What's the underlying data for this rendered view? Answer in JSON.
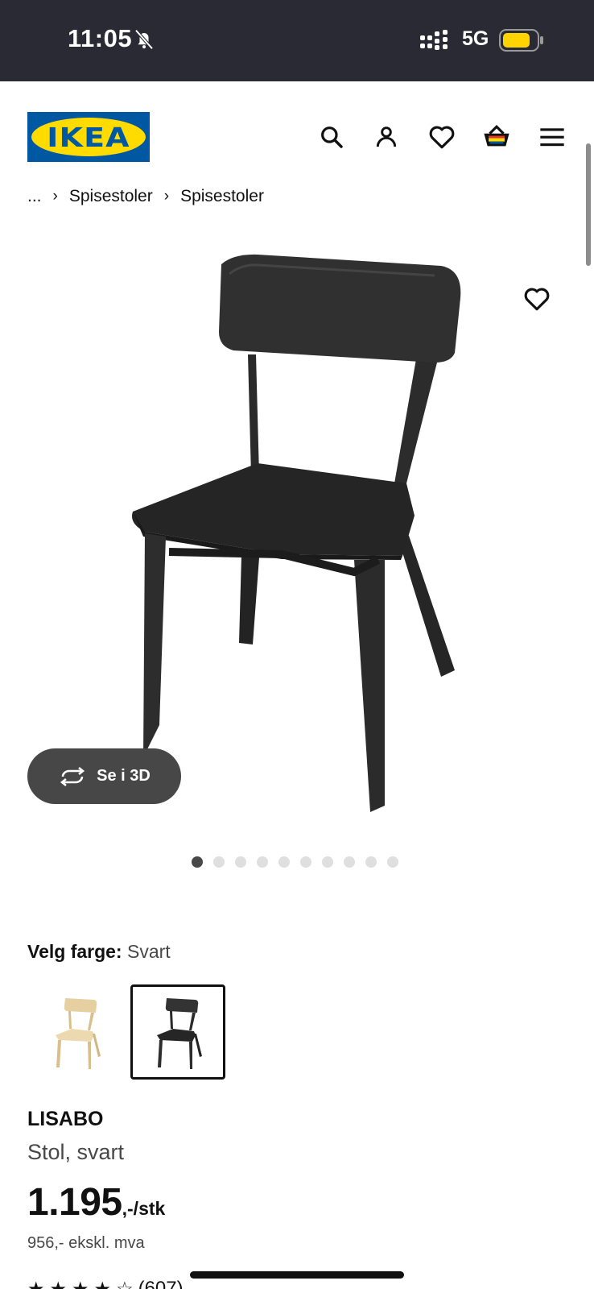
{
  "status_bar": {
    "time": "11:05",
    "network": "5G",
    "battery_color": "#ffd400"
  },
  "header": {
    "logo_text": "IKEA",
    "icons": [
      "search-icon",
      "account-icon",
      "favourites-icon",
      "cart-icon",
      "menu-icon"
    ]
  },
  "breadcrumb": {
    "items": [
      "...",
      "Spisestoler",
      "Spisestoler"
    ]
  },
  "gallery": {
    "see_3d_label": "Se i 3D",
    "image_count": 10,
    "active_index": 0
  },
  "color_choice": {
    "label": "Velg farge:",
    "value": "Svart",
    "swatches": [
      {
        "name": "light-wood",
        "color": "#e8d3a6",
        "selected": false
      },
      {
        "name": "black",
        "color": "#2b2b2b",
        "selected": true
      }
    ]
  },
  "product": {
    "name": "LISABO",
    "description": "Stol, svart",
    "price": "1.195",
    "price_suffix": ",-/stk",
    "price_excl_vat": "956,- ekskl. mva",
    "rating_count": "(607)"
  },
  "colors": {
    "accent_blue": "#0058a3",
    "accent_yellow": "#ffdb00",
    "status_bg": "#2a2a35"
  }
}
